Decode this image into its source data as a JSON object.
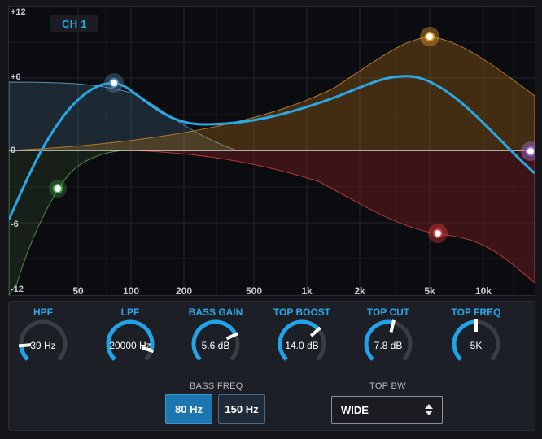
{
  "channel": "CH 1",
  "graph": {
    "y_ticks": [
      "+12",
      "+6",
      "0",
      "-6",
      "-12"
    ],
    "x_ticks": [
      "50",
      "100",
      "200",
      "500",
      "1k",
      "2k",
      "5k",
      "10k"
    ],
    "colors": {
      "response": "#29a8e8",
      "hpf": "#4fae4f",
      "lpf": "#5a8fb0",
      "top_boost": "#e0a030",
      "top_cut": "#d94040",
      "top_freq": "#a070d0"
    }
  },
  "knobs": [
    {
      "label": "HPF",
      "value": "39 Hz",
      "fraction": 0.15
    },
    {
      "label": "LPF",
      "value": "20000 Hz",
      "fraction": 0.9
    },
    {
      "label": "BASS GAIN",
      "value": "5.6 dB",
      "fraction": 0.74
    },
    {
      "label": "TOP BOOST",
      "value": "14.0 dB",
      "fraction": 0.68
    },
    {
      "label": "TOP CUT",
      "value": "7.8 dB",
      "fraction": 0.55
    },
    {
      "label": "TOP FREQ",
      "value": "5K",
      "fraction": 0.5
    }
  ],
  "bass_freq": {
    "label": "BASS FREQ",
    "options": [
      "80 Hz",
      "150 Hz"
    ],
    "selected": "80 Hz"
  },
  "top_bw": {
    "label": "TOP BW",
    "value": "WIDE"
  }
}
